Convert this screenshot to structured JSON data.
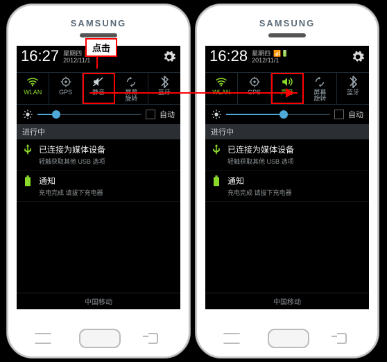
{
  "brand": "SAMSUNG",
  "callout": "点击",
  "date_weekday": "星期四",
  "date_value": "2012/11/1",
  "brightness_auto": "自动",
  "section_ongoing": "进行中",
  "carrier": "中国移动",
  "toggles": {
    "wlan": "WLAN",
    "gps": "GPS",
    "mute": "静音",
    "sound": "声音",
    "rotate": "屏幕\n旋转",
    "bt": "蓝牙"
  },
  "items": {
    "media": {
      "title": "已连接为媒体设备",
      "sub": "轻触获取其他 USB 选项"
    },
    "notify": {
      "title": "通知",
      "sub_left": "充电完成 请拔下充电器",
      "sub_right": "充电完成 请拔下充电器"
    }
  },
  "phones": {
    "left": {
      "time": "16:27",
      "slider_pct": 18
    },
    "right": {
      "time": "16:28",
      "slider_pct": 55
    }
  }
}
